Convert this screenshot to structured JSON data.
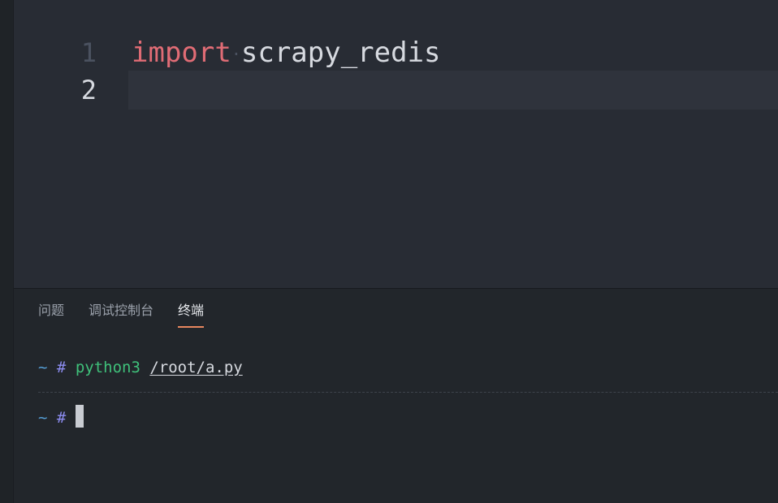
{
  "editor": {
    "lines": [
      {
        "number": "1",
        "keyword": "import",
        "whitespace_marker": "·",
        "rest": "scrapy_redis"
      },
      {
        "number": "2",
        "keyword": "",
        "whitespace_marker": "",
        "rest": ""
      }
    ],
    "active_line": 2
  },
  "panel": {
    "tabs": [
      {
        "label": "问题"
      },
      {
        "label": "调试控制台"
      },
      {
        "label": "终端"
      }
    ],
    "active_tab": "终端",
    "accent": "#e8875f"
  },
  "terminal": {
    "rows": [
      {
        "tilde": "~",
        "hash": "#",
        "command": "python3",
        "argument": "/root/a.py"
      },
      {
        "tilde": "~",
        "hash": "#",
        "command": "",
        "argument": ""
      }
    ]
  }
}
